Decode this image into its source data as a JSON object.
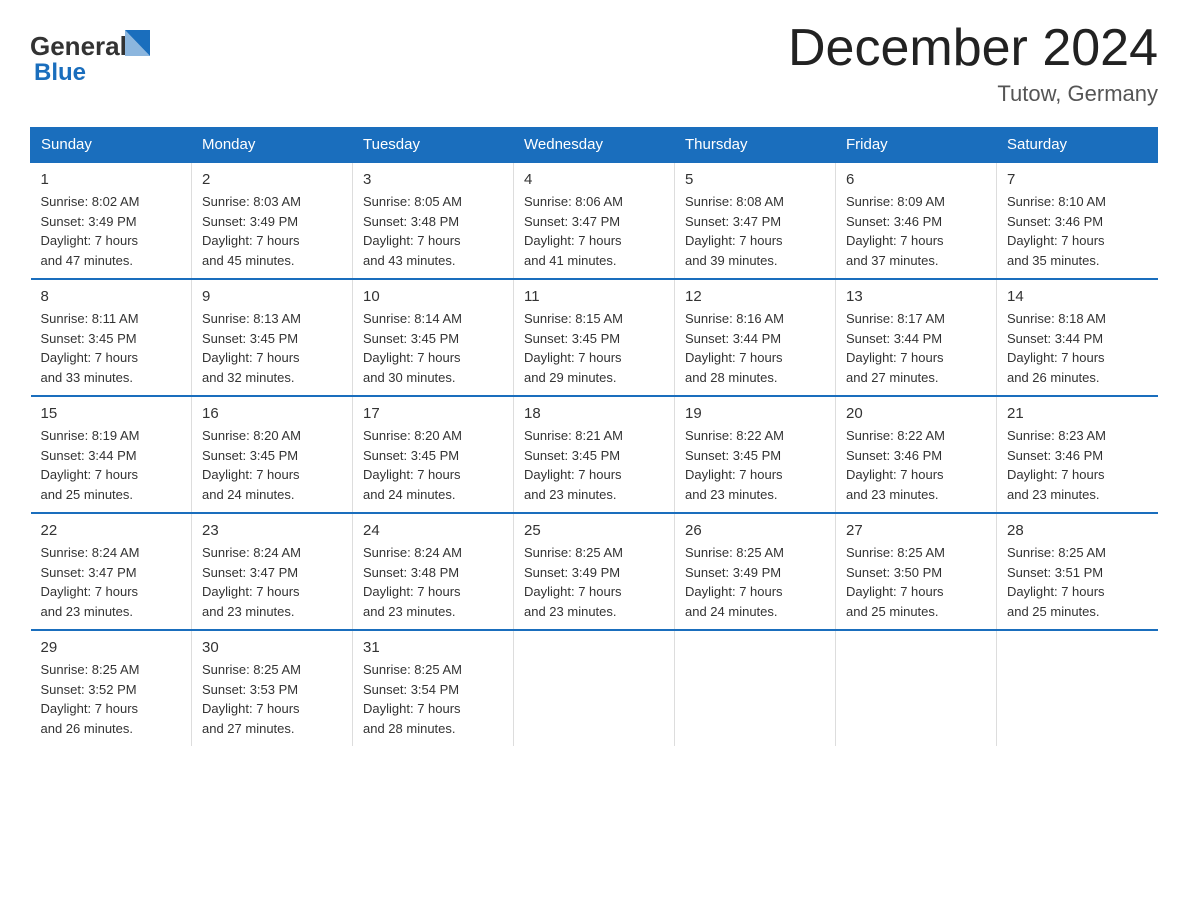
{
  "header": {
    "logo_general": "General",
    "logo_blue": "Blue",
    "title": "December 2024",
    "location": "Tutow, Germany"
  },
  "weekdays": [
    "Sunday",
    "Monday",
    "Tuesday",
    "Wednesday",
    "Thursday",
    "Friday",
    "Saturday"
  ],
  "weeks": [
    [
      {
        "day": "1",
        "sunrise": "8:02 AM",
        "sunset": "3:49 PM",
        "daylight": "7 hours and 47 minutes."
      },
      {
        "day": "2",
        "sunrise": "8:03 AM",
        "sunset": "3:49 PM",
        "daylight": "7 hours and 45 minutes."
      },
      {
        "day": "3",
        "sunrise": "8:05 AM",
        "sunset": "3:48 PM",
        "daylight": "7 hours and 43 minutes."
      },
      {
        "day": "4",
        "sunrise": "8:06 AM",
        "sunset": "3:47 PM",
        "daylight": "7 hours and 41 minutes."
      },
      {
        "day": "5",
        "sunrise": "8:08 AM",
        "sunset": "3:47 PM",
        "daylight": "7 hours and 39 minutes."
      },
      {
        "day": "6",
        "sunrise": "8:09 AM",
        "sunset": "3:46 PM",
        "daylight": "7 hours and 37 minutes."
      },
      {
        "day": "7",
        "sunrise": "8:10 AM",
        "sunset": "3:46 PM",
        "daylight": "7 hours and 35 minutes."
      }
    ],
    [
      {
        "day": "8",
        "sunrise": "8:11 AM",
        "sunset": "3:45 PM",
        "daylight": "7 hours and 33 minutes."
      },
      {
        "day": "9",
        "sunrise": "8:13 AM",
        "sunset": "3:45 PM",
        "daylight": "7 hours and 32 minutes."
      },
      {
        "day": "10",
        "sunrise": "8:14 AM",
        "sunset": "3:45 PM",
        "daylight": "7 hours and 30 minutes."
      },
      {
        "day": "11",
        "sunrise": "8:15 AM",
        "sunset": "3:45 PM",
        "daylight": "7 hours and 29 minutes."
      },
      {
        "day": "12",
        "sunrise": "8:16 AM",
        "sunset": "3:44 PM",
        "daylight": "7 hours and 28 minutes."
      },
      {
        "day": "13",
        "sunrise": "8:17 AM",
        "sunset": "3:44 PM",
        "daylight": "7 hours and 27 minutes."
      },
      {
        "day": "14",
        "sunrise": "8:18 AM",
        "sunset": "3:44 PM",
        "daylight": "7 hours and 26 minutes."
      }
    ],
    [
      {
        "day": "15",
        "sunrise": "8:19 AM",
        "sunset": "3:44 PM",
        "daylight": "7 hours and 25 minutes."
      },
      {
        "day": "16",
        "sunrise": "8:20 AM",
        "sunset": "3:45 PM",
        "daylight": "7 hours and 24 minutes."
      },
      {
        "day": "17",
        "sunrise": "8:20 AM",
        "sunset": "3:45 PM",
        "daylight": "7 hours and 24 minutes."
      },
      {
        "day": "18",
        "sunrise": "8:21 AM",
        "sunset": "3:45 PM",
        "daylight": "7 hours and 23 minutes."
      },
      {
        "day": "19",
        "sunrise": "8:22 AM",
        "sunset": "3:45 PM",
        "daylight": "7 hours and 23 minutes."
      },
      {
        "day": "20",
        "sunrise": "8:22 AM",
        "sunset": "3:46 PM",
        "daylight": "7 hours and 23 minutes."
      },
      {
        "day": "21",
        "sunrise": "8:23 AM",
        "sunset": "3:46 PM",
        "daylight": "7 hours and 23 minutes."
      }
    ],
    [
      {
        "day": "22",
        "sunrise": "8:24 AM",
        "sunset": "3:47 PM",
        "daylight": "7 hours and 23 minutes."
      },
      {
        "day": "23",
        "sunrise": "8:24 AM",
        "sunset": "3:47 PM",
        "daylight": "7 hours and 23 minutes."
      },
      {
        "day": "24",
        "sunrise": "8:24 AM",
        "sunset": "3:48 PM",
        "daylight": "7 hours and 23 minutes."
      },
      {
        "day": "25",
        "sunrise": "8:25 AM",
        "sunset": "3:49 PM",
        "daylight": "7 hours and 23 minutes."
      },
      {
        "day": "26",
        "sunrise": "8:25 AM",
        "sunset": "3:49 PM",
        "daylight": "7 hours and 24 minutes."
      },
      {
        "day": "27",
        "sunrise": "8:25 AM",
        "sunset": "3:50 PM",
        "daylight": "7 hours and 25 minutes."
      },
      {
        "day": "28",
        "sunrise": "8:25 AM",
        "sunset": "3:51 PM",
        "daylight": "7 hours and 25 minutes."
      }
    ],
    [
      {
        "day": "29",
        "sunrise": "8:25 AM",
        "sunset": "3:52 PM",
        "daylight": "7 hours and 26 minutes."
      },
      {
        "day": "30",
        "sunrise": "8:25 AM",
        "sunset": "3:53 PM",
        "daylight": "7 hours and 27 minutes."
      },
      {
        "day": "31",
        "sunrise": "8:25 AM",
        "sunset": "3:54 PM",
        "daylight": "7 hours and 28 minutes."
      },
      null,
      null,
      null,
      null
    ]
  ],
  "labels": {
    "sunrise": "Sunrise:",
    "sunset": "Sunset:",
    "daylight": "Daylight:"
  }
}
